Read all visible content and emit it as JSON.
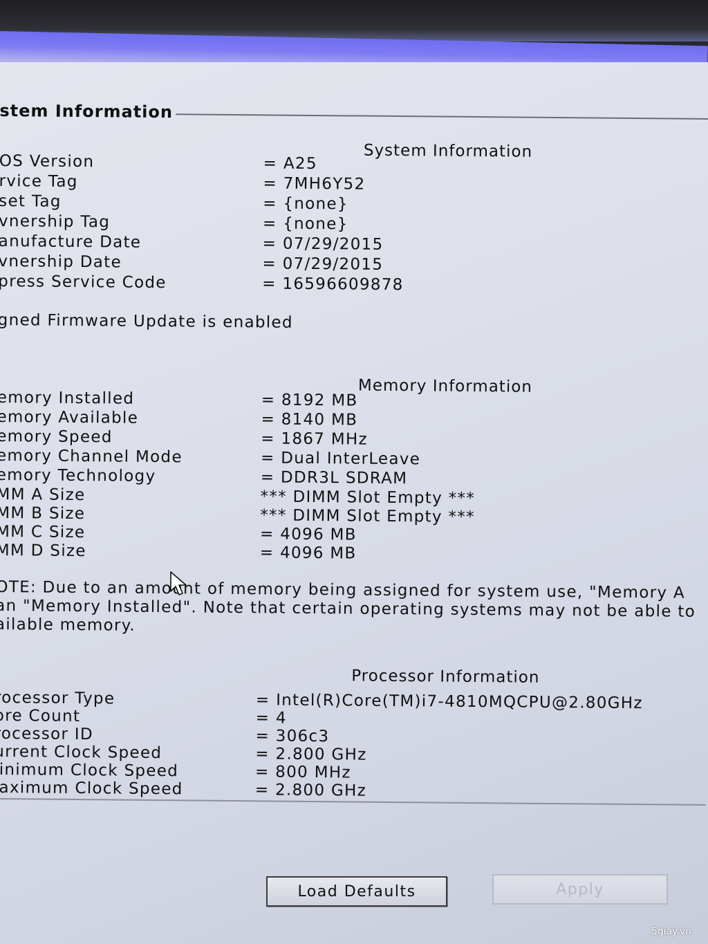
{
  "section": {
    "title": "stem Information"
  },
  "system": {
    "title": "System Information",
    "rows": [
      {
        "label": "OS Version",
        "value": "= A25"
      },
      {
        "label": "rvice Tag",
        "value": "= 7MH6Y52"
      },
      {
        "label": "set Tag",
        "value": "= {none}"
      },
      {
        "label": "vnership Tag",
        "value": "= {none}"
      },
      {
        "label": "anufacture Date",
        "value": "= 07/29/2015"
      },
      {
        "label": "vnership Date",
        "value": "= 07/29/2015"
      },
      {
        "label": "press Service Code",
        "value": "= 16596609878"
      }
    ],
    "firmware_note": "gned Firmware Update is enabled"
  },
  "memory": {
    "title": "Memory Information",
    "rows": [
      {
        "label": "emory Installed",
        "value": "= 8192 MB"
      },
      {
        "label": "emory Available",
        "value": "= 8140 MB"
      },
      {
        "label": "emory Speed",
        "value": "= 1867 MHz"
      },
      {
        "label": "emory Channel Mode",
        "value": "= Dual InterLeave"
      },
      {
        "label": "emory Technology",
        "value": "= DDR3L SDRAM"
      },
      {
        "label": "MM A Size",
        "value": "*** DIMM Slot Empty ***"
      },
      {
        "label": "MM B Size",
        "value": "*** DIMM Slot Empty ***"
      },
      {
        "label": "MM C Size",
        "value": "= 4096 MB"
      },
      {
        "label": "MM D Size",
        "value": "= 4096 MB"
      }
    ],
    "note_lines": [
      "OTE: Due to an amount of memory being assigned for system use, \"Memory A",
      "an \"Memory Installed\". Note that certain operating systems may not be able to",
      "ailable memory."
    ]
  },
  "processor": {
    "title": "Processor Information",
    "rows": [
      {
        "label": "rocessor Type",
        "value": "= Intel(R)Core(TM)i7-4810MQCPU@2.80GHz"
      },
      {
        "label": "ore Count",
        "value": "= 4"
      },
      {
        "label": "rocessor ID",
        "value": "= 306c3"
      },
      {
        "label": "urrent Clock Speed",
        "value": "= 2.800 GHz"
      },
      {
        "label": "linimum Clock Speed",
        "value": "= 800 MHz"
      },
      {
        "label": "laximum Clock Speed",
        "value": "= 2.800 GHz"
      }
    ]
  },
  "buttons": {
    "load_defaults": "Load Defaults",
    "apply": "Apply"
  },
  "watermark": "5giay.vn",
  "colors": {
    "title_bar": "#7e7bf3",
    "panel": "#dcdfe9",
    "disabled_text": "#b6b9c3"
  }
}
